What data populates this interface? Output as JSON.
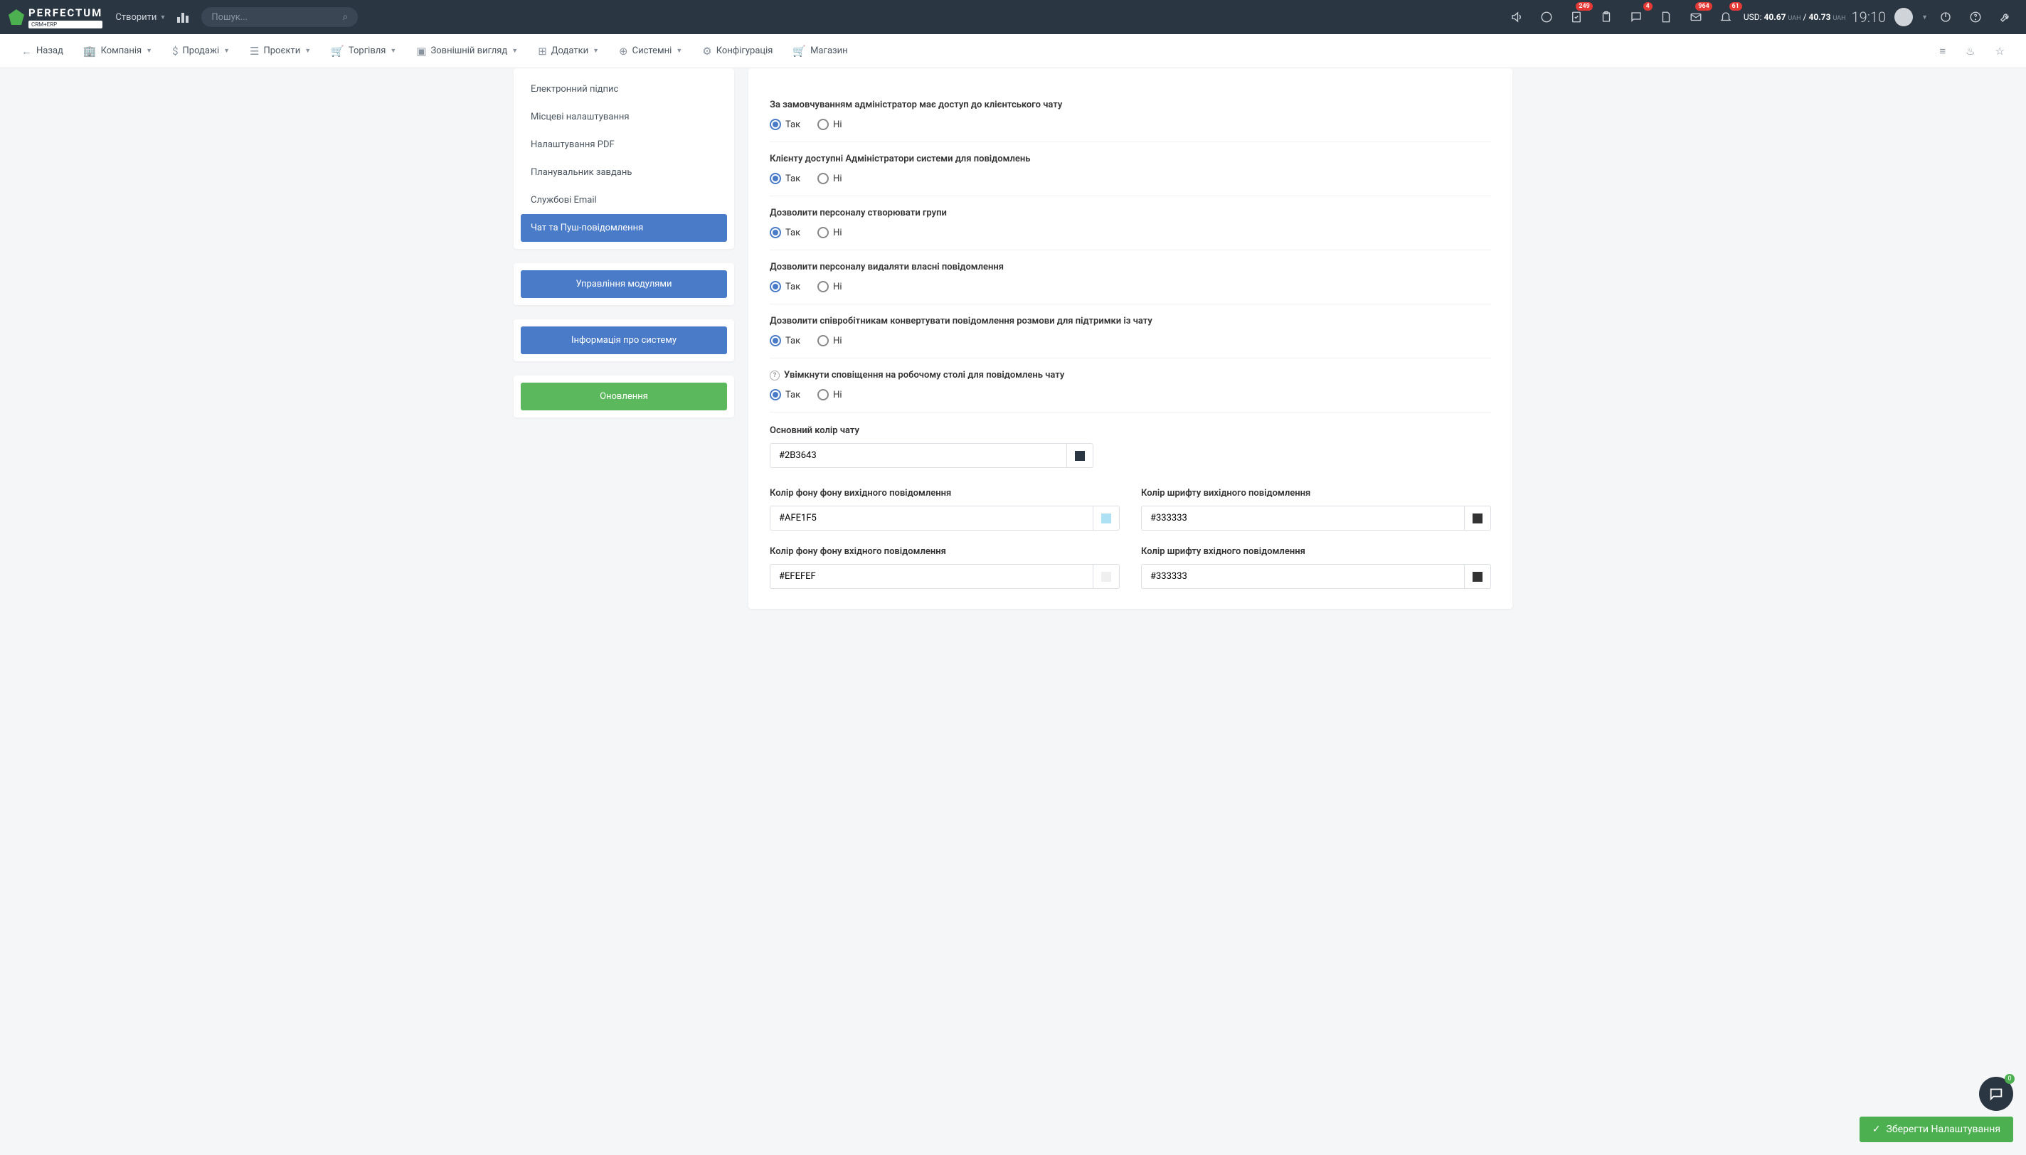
{
  "topbar": {
    "logo_text": "PERFECTUM",
    "logo_sub": "CRM+ERP",
    "create_label": "Створити",
    "search_placeholder": "Пошук...",
    "badges": {
      "todo": "249",
      "chat": "4",
      "mail": "964",
      "bell": "61"
    },
    "currency_pre": "USD: ",
    "currency_val1": "40.67",
    "currency_uah1": "UAH",
    "currency_sep": " / ",
    "currency_val2": "40.73",
    "currency_uah2": "UAH",
    "time": "19:10"
  },
  "nav": {
    "back": "Назад",
    "items": [
      "Компанія",
      "Продажі",
      "Проєкти",
      "Торгівля",
      "Зовнішній вигляд",
      "Додатки",
      "Системні",
      "Конфігурація",
      "Магазин"
    ]
  },
  "sidebar": {
    "items": [
      "Електронний підпис",
      "Місцеві налаштування",
      "Налаштування PDF",
      "Планувальник завдань",
      "Службові Email",
      "Чат та Пуш-повідомлення"
    ],
    "modules_btn": "Управління модулями",
    "sysinfo_btn": "Інформація про систему",
    "update_btn": "Оновлення"
  },
  "form": {
    "yes": "Так",
    "no": "Ні",
    "q1": "За замовчуванням адміністратор має доступ до клієнтського чату",
    "q2": "Клієнту доступні Адміністратори системи для повідомлень",
    "q3": "Дозволити персоналу створювати групи",
    "q4": "Дозволити персоналу видаляти власні повідомлення",
    "q5": "Дозволити співробітникам конвертувати повідомлення розмови для підтримки із чату",
    "q6": "Увімкнути сповіщення на робочому столі для повідомлень чату",
    "color_main_label": "Основний колір чату",
    "color_main": "#2B3643",
    "color_out_bg_label": "Колір фону фону вихідного повідомлення",
    "color_out_bg": "#AFE1F5",
    "color_out_font_label": "Колір шрифту вихідного повідомлення",
    "color_out_font": "#333333",
    "color_in_bg_label": "Колір фону фону вхідного повідомлення",
    "color_in_bg": "#EFEFEF",
    "color_in_font_label": "Колір шрифту вхідного повідомлення",
    "color_in_font": "#333333"
  },
  "save_btn": "Зберегти Налаштування",
  "fab_badge": "0"
}
